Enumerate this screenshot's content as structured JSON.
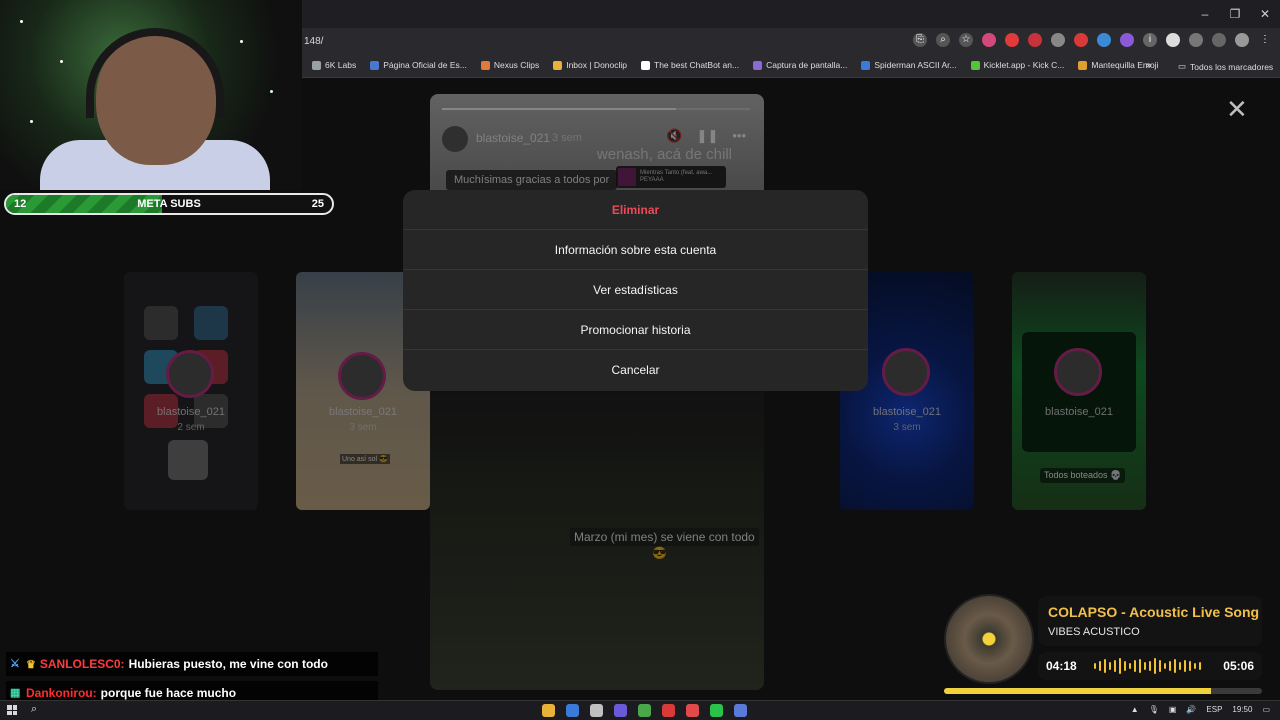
{
  "browser": {
    "url": "148/",
    "window_controls": [
      "–",
      "❐",
      "✕"
    ],
    "bookmarks": [
      {
        "label": "6K Labs",
        "color": "#9aa0a6"
      },
      {
        "label": "Página Oficial de Es...",
        "color": "#4a78d0"
      },
      {
        "label": "Nexus Clips",
        "color": "#e07a3a"
      },
      {
        "label": "Inbox | Donoclip",
        "color": "#e8b23a"
      },
      {
        "label": "The best ChatBot an...",
        "color": "#ffffff"
      },
      {
        "label": "Captura de pantalla...",
        "color": "#8a6ad8"
      },
      {
        "label": "Spiderman ASCII Ar...",
        "color": "#3a7ad8"
      },
      {
        "label": "Kicklet.app - Kick C...",
        "color": "#53c33a"
      },
      {
        "label": "Mantequilla Emoji",
        "color": "#e0a030"
      }
    ],
    "bookmarks_more": "»",
    "all_bookmarks": "Todos los marcadores"
  },
  "stories": {
    "left_cards": [
      {
        "user": "blastoise_021",
        "time": "2 sem"
      },
      {
        "user": "blastoise_021",
        "time": "3 sem",
        "caption": "Uno así sol 😎"
      }
    ],
    "right_cards": [
      {
        "user": "blastoise_021",
        "time": "3 sem"
      },
      {
        "user": "blastoise_021",
        "footer": "Todos boteados 💀"
      }
    ],
    "center": {
      "user": "blastoise_021",
      "time": "3 sem",
      "progress": 0.76,
      "caption_top": "wenash, acá de chill",
      "message": "Muchísimas gracias a todos por",
      "music_line1": "Mientras Tanto (feat. awa...",
      "music_line2": "PEYAAA",
      "bottom_text": "Marzo (mi mes) se viene con todo",
      "bottom_emoji": "😎"
    }
  },
  "modal": {
    "items": [
      {
        "label": "Eliminar",
        "danger": true
      },
      {
        "label": "Información sobre esta cuenta"
      },
      {
        "label": "Ver estadísticas"
      },
      {
        "label": "Promocionar historia"
      },
      {
        "label": "Cancelar"
      }
    ]
  },
  "subs_goal": {
    "current": "12",
    "label": "META SUBS",
    "target": "25",
    "progress": 0.48
  },
  "chat": [
    {
      "user": "SANLOLESC0:",
      "message": "Hubieras puesto, me vine con todo"
    },
    {
      "user": "Dankonirou:",
      "message": "porque fue hace mucho"
    }
  ],
  "music_widget": {
    "title": "COLAPSO - Acoustic Live Song",
    "artist": "VIBES ACUSTICO",
    "current_time": "04:18",
    "total_time": "05:06",
    "progress": 0.84
  },
  "taskbar": {
    "language": "ESP",
    "clock": "19:50",
    "apps": [
      "#e8b23a",
      "#3a7ad8",
      "#c0c0c0",
      "#6a5ad8",
      "#4aa84a",
      "#d83a3a",
      "#e04a4a",
      "#2ac24a",
      "#5a7ad8"
    ]
  },
  "colors": {
    "danger": "#ed4956",
    "accent_yellow": "#f2c04a"
  }
}
